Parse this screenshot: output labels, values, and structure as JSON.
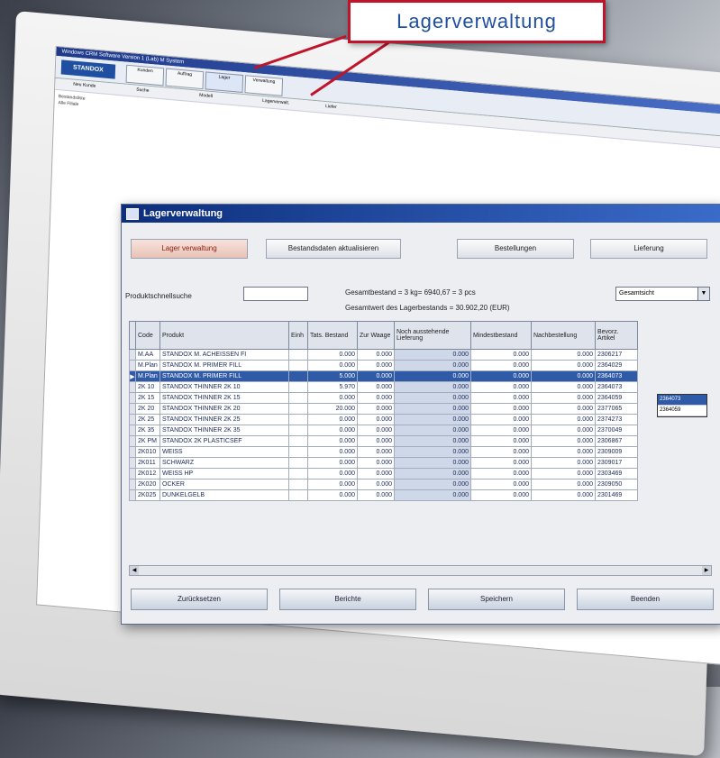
{
  "background_window": {
    "title": "Windows CRM Software Version 1 (Lab) M System",
    "logo": "STANDOX",
    "tabs": [
      "Kunden",
      "Auftrag",
      "Lager",
      "Verwaltung"
    ],
    "subnav": [
      "Neu Kunde",
      "Suche",
      "Modell",
      "Lagerverwalt.",
      "Liefer"
    ],
    "side": [
      "Bestandsliste",
      "Alle Filiale"
    ]
  },
  "callout": {
    "text": "Lagerverwaltung",
    "color": "#c0142a"
  },
  "window": {
    "title": "Lagerverwaltung",
    "top_buttons": [
      "Lager verwaltung",
      "Bestandsdaten aktualisieren",
      "Bestellungen",
      "Lieferung"
    ],
    "search_label": "Produktschnellsuche",
    "search_value": "",
    "summary_line1": "Gesamtbestand = 3 kg= 6940,67 = 3 pcs",
    "summary_line2": "Gesamtwert des Lagerbestands = 30.902,20 (EUR)",
    "filter_select": "Gesamtsicht",
    "columns": [
      "Code",
      "Produkt",
      "Einh",
      "Tats. Bestand",
      "Zur Waage",
      "Noch ausstehende Lieferung",
      "Mindestbestand",
      "Nachbestellung",
      "Bevorz. Artikel"
    ],
    "rows": [
      {
        "code": "M.AA",
        "produkt": "STANDOX M. ACHEISSEN FI",
        "einh": "",
        "bestand": "0.000",
        "waage": "0.000",
        "ausst": "0.000",
        "mind": "0.000",
        "nach": "0.000",
        "art": "2306217"
      },
      {
        "code": "M.Plan",
        "produkt": "STANDOX M. PRIMER FILL",
        "einh": "",
        "bestand": "0.000",
        "waage": "0.000",
        "ausst": "0.000",
        "mind": "0.000",
        "nach": "0.000",
        "art": "2364029"
      },
      {
        "code": "M.Plan",
        "produkt": "STANDOX M. PRIMER FILL",
        "einh": "",
        "bestand": "5.000",
        "waage": "0.000",
        "ausst": "0.000",
        "mind": "0.000",
        "nach": "0.000",
        "art": "2364073"
      },
      {
        "code": "2K 10",
        "produkt": "STANDOX THINNER 2K 10",
        "einh": "",
        "bestand": "5.970",
        "waage": "0.000",
        "ausst": "0.000",
        "mind": "0.000",
        "nach": "0.000",
        "art": "2364073"
      },
      {
        "code": "2K 15",
        "produkt": "STANDOX THINNER 2K 15",
        "einh": "",
        "bestand": "0.000",
        "waage": "0.000",
        "ausst": "0.000",
        "mind": "0.000",
        "nach": "0.000",
        "art": "2364059"
      },
      {
        "code": "2K 20",
        "produkt": "STANDOX THINNER 2K 20",
        "einh": "",
        "bestand": "20.000",
        "waage": "0.000",
        "ausst": "0.000",
        "mind": "0.000",
        "nach": "0.000",
        "art": "2377065"
      },
      {
        "code": "2K 25",
        "produkt": "STANDOX THINNER 2K 25",
        "einh": "",
        "bestand": "0.000",
        "waage": "0.000",
        "ausst": "0.000",
        "mind": "0.000",
        "nach": "0.000",
        "art": "2374273"
      },
      {
        "code": "2K 35",
        "produkt": "STANDOX THINNER 2K 35",
        "einh": "",
        "bestand": "0.000",
        "waage": "0.000",
        "ausst": "0.000",
        "mind": "0.000",
        "nach": "0.000",
        "art": "2370049"
      },
      {
        "code": "2K PM",
        "produkt": "STANDOX 2K PLASTICSEF",
        "einh": "",
        "bestand": "0.000",
        "waage": "0.000",
        "ausst": "0.000",
        "mind": "0.000",
        "nach": "0.000",
        "art": "2306867"
      },
      {
        "code": "2K010",
        "produkt": "WEISS",
        "einh": "",
        "bestand": "0.000",
        "waage": "0.000",
        "ausst": "0.000",
        "mind": "0.000",
        "nach": "0.000",
        "art": "2309009"
      },
      {
        "code": "2K011",
        "produkt": "SCHWARZ",
        "einh": "",
        "bestand": "0.000",
        "waage": "0.000",
        "ausst": "0.000",
        "mind": "0.000",
        "nach": "0.000",
        "art": "2309017"
      },
      {
        "code": "2K012",
        "produkt": "WEISS HP",
        "einh": "",
        "bestand": "0.000",
        "waage": "0.000",
        "ausst": "0.000",
        "mind": "0.000",
        "nach": "0.000",
        "art": "2303469"
      },
      {
        "code": "2K020",
        "produkt": "OCKER",
        "einh": "",
        "bestand": "0.000",
        "waage": "0.000",
        "ausst": "0.000",
        "mind": "0.000",
        "nach": "0.000",
        "art": "2309050"
      },
      {
        "code": "2K025",
        "produkt": "DUNKELGELB",
        "einh": "",
        "bestand": "0.000",
        "waage": "0.000",
        "ausst": "0.000",
        "mind": "0.000",
        "nach": "0.000",
        "art": "2301469"
      }
    ],
    "dropdown_options": [
      "2364073",
      "2364059"
    ],
    "bottom_buttons": [
      "Zurücksetzen",
      "Berichte",
      "Speichern",
      "Beenden"
    ]
  }
}
